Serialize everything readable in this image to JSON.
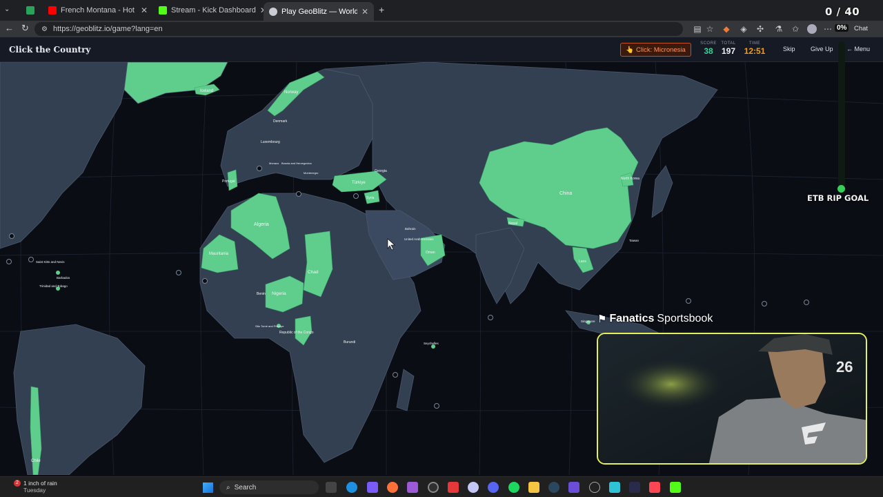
{
  "browser": {
    "tabs": [
      {
        "label": "",
        "favicon_color": "#2aa35a",
        "active": false
      },
      {
        "label": "French Montana - Hot Boy Bling ft",
        "favicon_color": "#ff0000",
        "active": false
      },
      {
        "label": "Stream - Kick Dashboard",
        "favicon_color": "#53fc18",
        "active": false
      },
      {
        "label": "Play GeoBlitz — World Geography",
        "favicon_color": "#c9ced6",
        "active": true
      }
    ],
    "new_tab": "+",
    "close_glyph": "✕",
    "url": "https://geoblitz.io/game?lang=en",
    "chat_label": "Chat",
    "percent_badge": "0%"
  },
  "header": {
    "title": "Click the Country",
    "prompt_label": "Click: Micronesia",
    "prompt_icon": "👆",
    "score_label": "SCORE",
    "score": "38",
    "total_label": "TOTAL",
    "total": "197",
    "time_label": "TIME",
    "time": "12:51",
    "skip_label": "Skip",
    "give_up_label": "Give Up",
    "menu_label": "← Menu"
  },
  "colors": {
    "found": "#5fce8c",
    "land": "#334052",
    "ocean": "#0a0d14",
    "score": "#34d399",
    "time": "#f59e0b",
    "goal": "#34d058",
    "webcam_border": "#e6f15a"
  },
  "map": {
    "country_labels": [
      "Iceland",
      "Norway",
      "Denmark",
      "Luxembourg",
      "Portugal",
      "Monaco",
      "Bosnia and Herzegovina",
      "Montenegro",
      "Türkiye",
      "Georgia",
      "Syria",
      "Algeria",
      "Mauritania",
      "Chad",
      "Nigeria",
      "Benin",
      "São Tomé and Príncipe",
      "Republic of the Congo",
      "Burundi",
      "Bahrain",
      "United Arab Emirates",
      "Oman",
      "Seychelles",
      "China",
      "North Korea",
      "Nepal",
      "Taiwan",
      "Laos",
      "Singapore",
      "Saint Kitts and Nevis",
      "Barbados",
      "Trinidad and Tobago",
      "Chile"
    ]
  },
  "overlay": {
    "counter": "0 / 40",
    "goal_label": "ETB RIP GOAL",
    "goal_progress": 0,
    "brand_bold": "Fanatics",
    "brand_rest": "Sportsbook",
    "jersey_number": "26"
  },
  "taskbar": {
    "weather_line1": "1 inch of rain",
    "weather_line2": "Tuesday",
    "weather_badge": "2",
    "search_placeholder": "Search"
  }
}
